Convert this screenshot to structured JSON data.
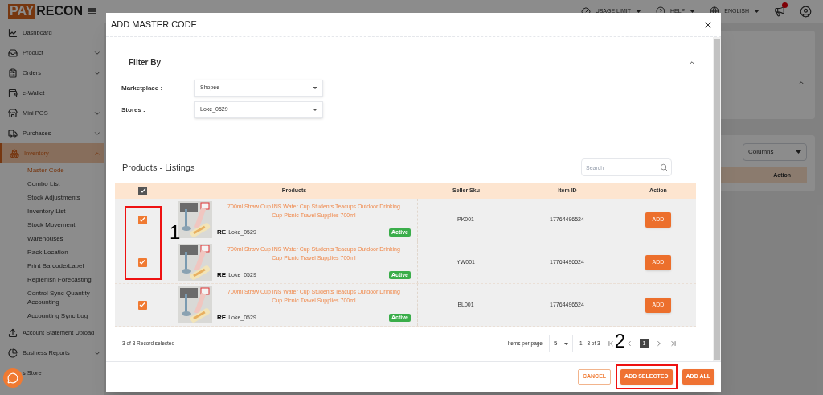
{
  "app": {
    "logo_left": "PAY",
    "logo_right": "RECON"
  },
  "header": {
    "items": [
      {
        "label": "USAGE LIMIT"
      },
      {
        "label": "HELP"
      },
      {
        "label": "ENGLISH"
      }
    ]
  },
  "sidebar": {
    "items": [
      {
        "label": "Dashboard",
        "selected": false
      },
      {
        "label": "Product",
        "selected": false,
        "expanded": false
      },
      {
        "label": "Orders",
        "selected": false,
        "expanded": false
      },
      {
        "label": "e-Wallet",
        "selected": false
      },
      {
        "label": "Mini POS",
        "selected": false,
        "expanded": false
      },
      {
        "label": "Purchases",
        "selected": false,
        "expanded": false
      },
      {
        "label": "Inventory",
        "selected": true,
        "expanded": true,
        "children": [
          {
            "label": "Master Code",
            "selected": true
          },
          {
            "label": "Combo List",
            "selected": false
          },
          {
            "label": "Stock Adjustments",
            "selected": false
          },
          {
            "label": "Inventory List",
            "selected": false
          },
          {
            "label": "Stock Movement",
            "selected": false
          },
          {
            "label": "Warehouses",
            "selected": false
          },
          {
            "label": "Rack Location",
            "selected": false
          },
          {
            "label": "Print Barcode/Label",
            "selected": false
          },
          {
            "label": "Replenish Forecasting",
            "selected": false
          },
          {
            "label": "Control Sync Quantity Accounting",
            "selected": false
          },
          {
            "label": "Accounting Sync Log",
            "selected": false
          }
        ]
      },
      {
        "label": "Account Statement Upload",
        "selected": false
      },
      {
        "label": "Business Reports",
        "selected": false,
        "expanded": false
      },
      {
        "label": "s Store",
        "selected": false
      }
    ]
  },
  "background": {
    "columns_select": "Columns",
    "table_header": "Action"
  },
  "modal": {
    "title": "ADD MASTER CODE",
    "filter": {
      "title": "Filter By",
      "expanded": true,
      "fields": [
        {
          "label": "Marketplace :",
          "value": "Shopee"
        },
        {
          "label": "Stores :",
          "value": "Loke_0529"
        }
      ]
    },
    "listing": {
      "title": "Products - Listings",
      "search": {
        "placeholder": "Search"
      },
      "all_checked": true,
      "columns": [
        "Products",
        "Seller Sku",
        "Item ID",
        "Action"
      ],
      "rows": [
        {
          "checked": true,
          "product": "700ml Straw Cup INS Water Cup Students Teacups Outdoor Drinking Cup Picnic Travel Supplies 700ml",
          "store_badge": "RE",
          "store": "Loke_0529",
          "status": "Active",
          "seller_sku": "PK001",
          "item_id": "17764496524",
          "action": "ADD"
        },
        {
          "checked": true,
          "product": "700ml Straw Cup INS Water Cup Students Teacups Outdoor Drinking Cup Picnic Travel Supplies 700ml",
          "store_badge": "RE",
          "store": "Loke_0529",
          "status": "Active",
          "seller_sku": "YW001",
          "item_id": "17764496524",
          "action": "ADD"
        },
        {
          "checked": true,
          "product": "700ml Straw Cup INS Water Cup Students Teacups Outdoor Drinking Cup Picnic Travel Supplies 700ml",
          "store_badge": "RE",
          "store": "Loke_0529",
          "status": "Active",
          "seller_sku": "BL001",
          "item_id": "17764496524",
          "action": "ADD"
        }
      ],
      "selection_summary": "3 of 3 Record selected",
      "pagination": {
        "items_per_page_label": "Items per page",
        "items_per_page": "5",
        "range": "1 - 3 of 3",
        "pages": [
          {
            "label": "1",
            "selected": true
          }
        ]
      }
    },
    "buttons": [
      {
        "label": "CANCEL",
        "kind": "outline",
        "highlighted": false
      },
      {
        "label": "ADD SELECTED",
        "kind": "filled",
        "highlighted": true
      },
      {
        "label": "ADD ALL",
        "kind": "filled",
        "highlighted": false
      }
    ]
  },
  "annotations": [
    {
      "label": "1"
    },
    {
      "label": "2"
    }
  ]
}
